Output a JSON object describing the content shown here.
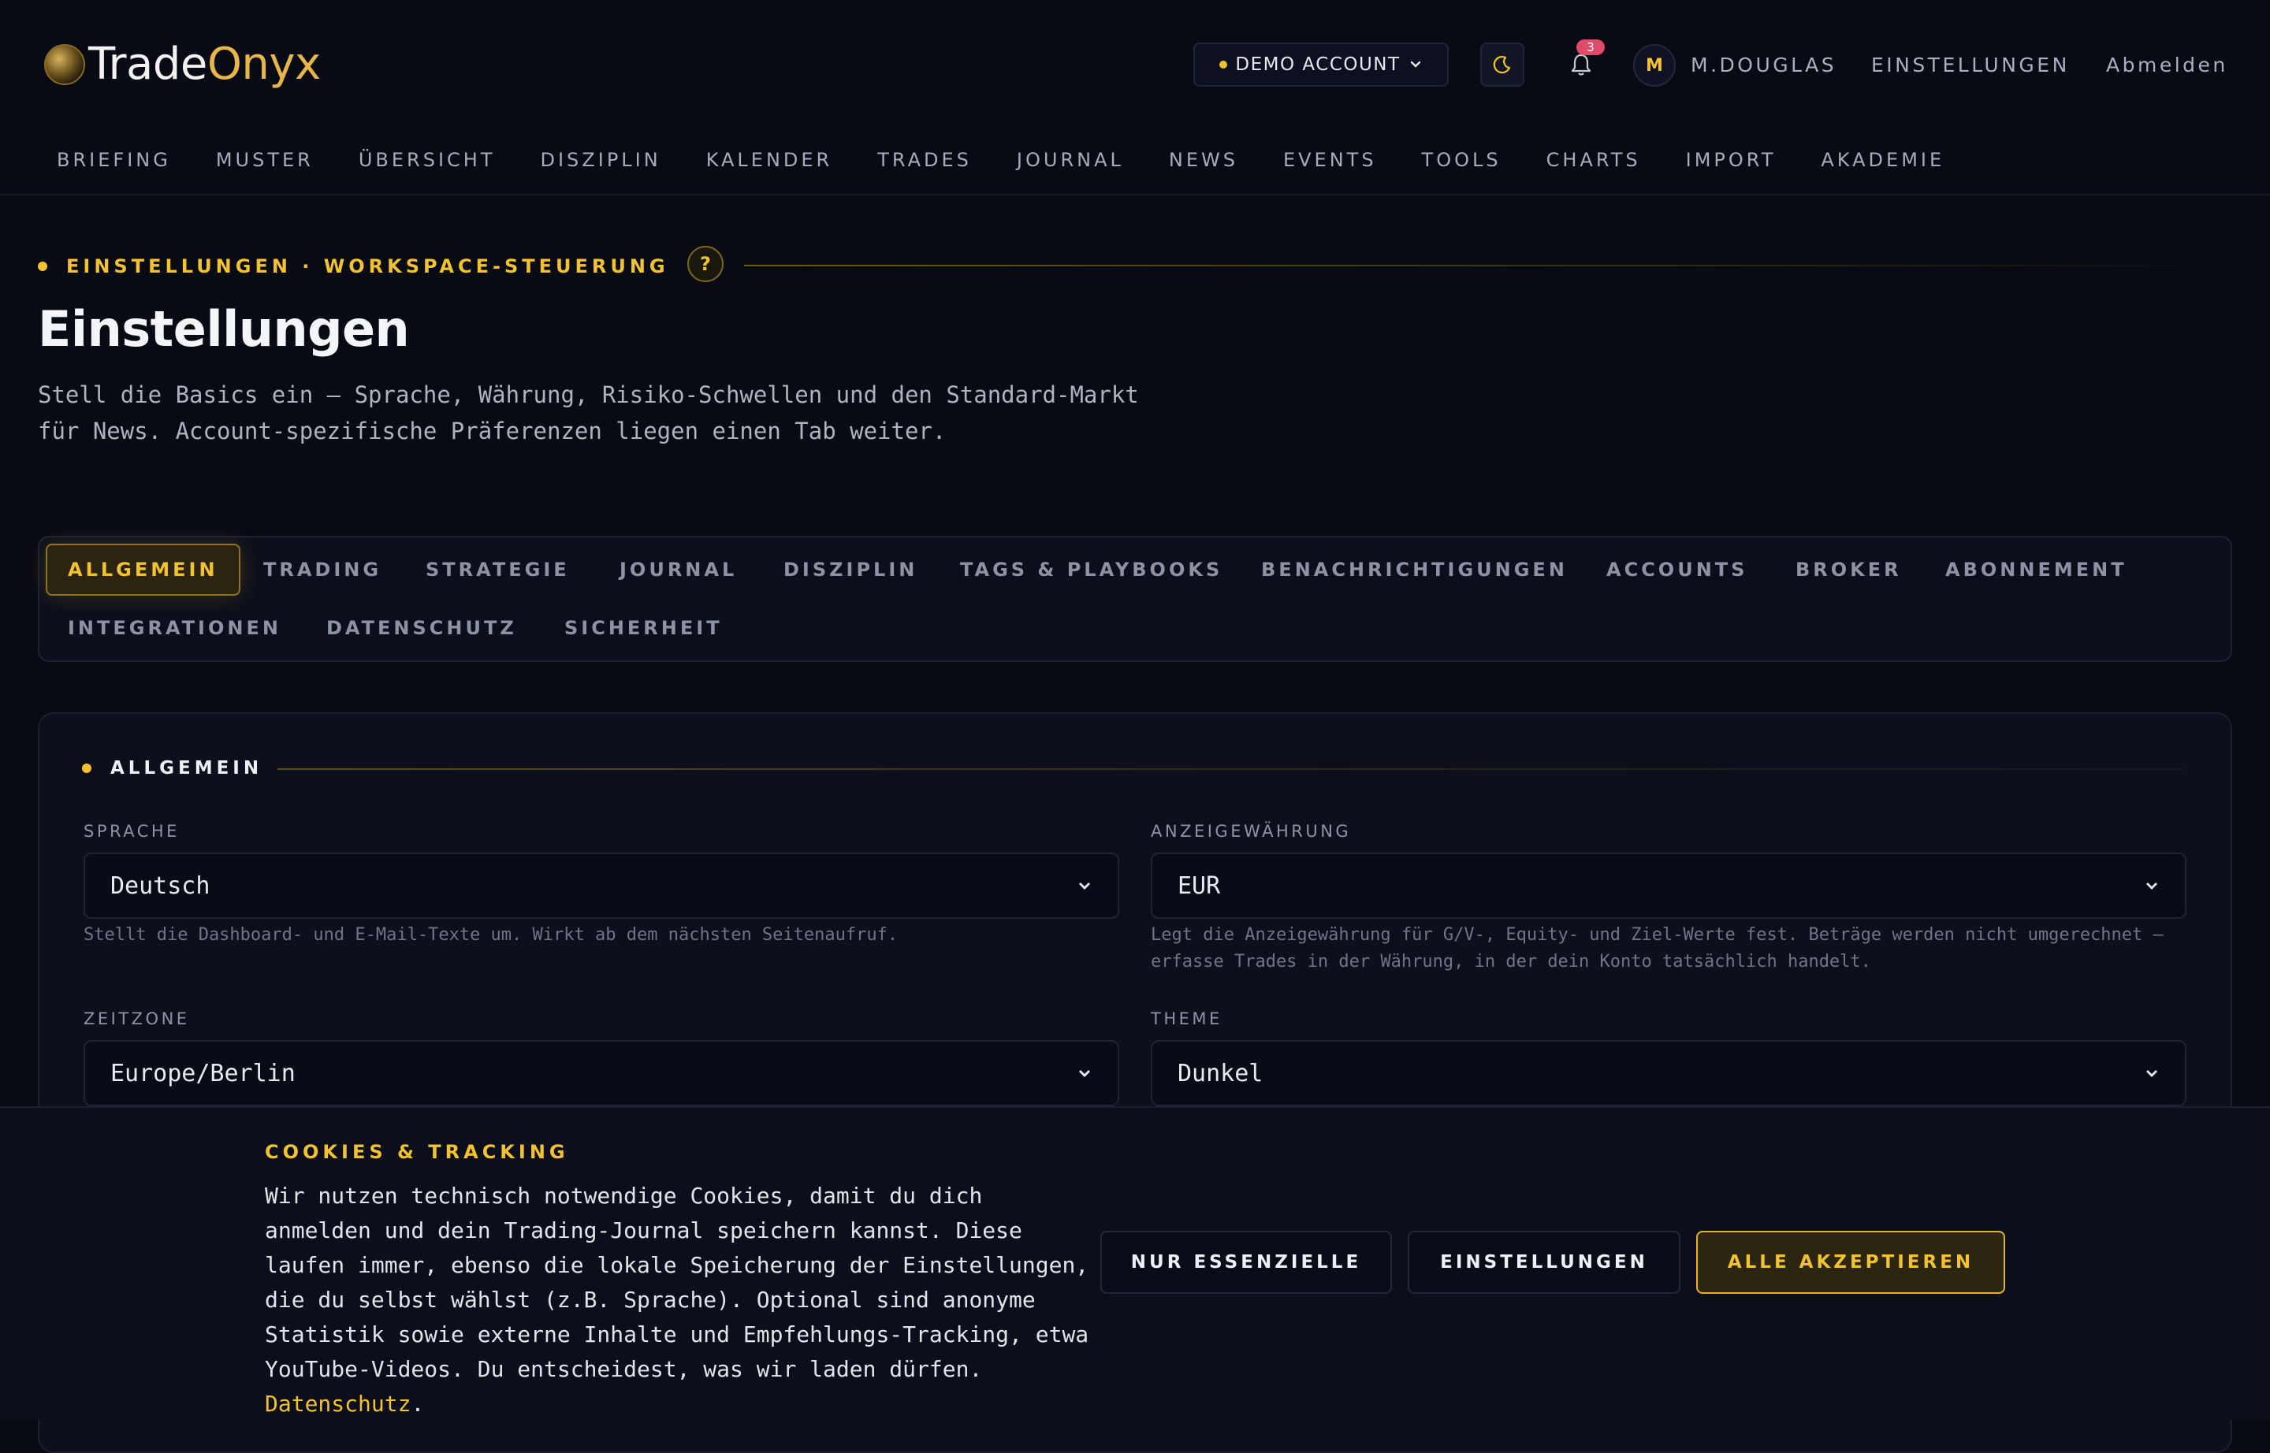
{
  "brand": {
    "name_part1": "Trade",
    "name_part2": "Onyx"
  },
  "header": {
    "account_selector": "DEMO ACCOUNT",
    "notifications_count": "3",
    "avatar_initial": "M",
    "username": "M.DOUGLAS",
    "settings_link": "EINSTELLUNGEN",
    "logout_link": "Abmelden"
  },
  "nav": [
    "BRIEFING",
    "MUSTER",
    "ÜBERSICHT",
    "DISZIPLIN",
    "KALENDER",
    "TRADES",
    "JOURNAL",
    "NEWS",
    "EVENTS",
    "TOOLS",
    "CHARTS",
    "IMPORT",
    "AKADEMIE"
  ],
  "page": {
    "eyebrow": "EINSTELLUNGEN · WORKSPACE-STEUERUNG",
    "help_label": "?",
    "title": "Einstellungen",
    "description": "Stell die Basics ein — Sprache, Währung, Risiko-Schwellen und den Standard-Markt für News. Account-spezifische Präferenzen liegen einen Tab weiter."
  },
  "tabs": {
    "active": "ALLGEMEIN",
    "items": [
      "ALLGEMEIN",
      "TRADING",
      "STRATEGIE",
      "JOURNAL",
      "DISZIPLIN",
      "TAGS & PLAYBOOKS",
      "BENACHRICHTIGUNGEN",
      "ACCOUNTS",
      "BROKER",
      "ABONNEMENT",
      "INTEGRATIONEN",
      "DATENSCHUTZ",
      "SICHERHEIT"
    ]
  },
  "section": {
    "title": "ALLGEMEIN",
    "fields": {
      "language": {
        "label": "SPRACHE",
        "value": "Deutsch",
        "help": "Stellt die Dashboard- und E-Mail-Texte um. Wirkt ab dem nächsten Seitenaufruf."
      },
      "currency": {
        "label": "ANZEIGEWÄHRUNG",
        "value": "EUR",
        "help": "Legt die Anzeigewährung für G/V-, Equity- und Ziel-Werte fest. Beträge werden nicht umgerechnet — erfasse Trades in der Währung, in der dein Konto tatsächlich handelt."
      },
      "timezone": {
        "label": "ZEITZONE",
        "value": "Europe/Berlin"
      },
      "theme": {
        "label": "THEME",
        "value": "Dunkel"
      }
    }
  },
  "cookie": {
    "title": "COOKIES & TRACKING",
    "text": "Wir nutzen technisch notwendige Cookies, damit du dich anmelden und dein Trading-Journal speichern kannst. Diese laufen immer, ebenso die lokale Speicherung der Einstellungen, die du selbst wählst (z.B. Sprache). Optional sind anonyme Statistik sowie externe Inhalte und Empfehlungs-Tracking, etwa YouTube-Videos. Du entscheidest, was wir laden dürfen.",
    "link": "Datenschutz",
    "link_suffix": ".",
    "btn_essential": "NUR ESSENZIELLE",
    "btn_settings": "EINSTELLUNGEN",
    "btn_accept": "ALLE AKZEPTIEREN"
  },
  "colors": {
    "accent": "#f2c230",
    "background": "#080a14",
    "badge": "#e24a6a"
  }
}
